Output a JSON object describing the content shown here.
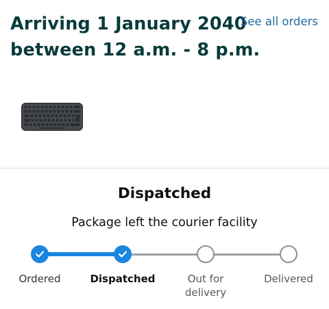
{
  "header": {
    "arrival_line1": "Arriving 1 January 2040",
    "arrival_line2": "between 12 a.m. - 8 p.m.",
    "see_all_orders": "See all orders"
  },
  "product": {
    "image_icon": "keyboard-product-image"
  },
  "status": {
    "title": "Dispatched",
    "subtitle": "Package left the courier facility"
  },
  "tracker": {
    "steps": [
      {
        "label_line1": "Ordered",
        "label_line2": "",
        "state": "done"
      },
      {
        "label_line1": "Dispatched",
        "label_line2": "",
        "state": "current"
      },
      {
        "label_line1": "Out for",
        "label_line2": "delivery",
        "state": "pending"
      },
      {
        "label_line1": "Delivered",
        "label_line2": "",
        "state": "pending"
      }
    ],
    "progress_fraction": 0.333
  },
  "colors": {
    "heading": "#0a3b3b",
    "link": "#1f6aa0",
    "progress_done": "#1a86e0",
    "progress_todo": "#9aa0a6"
  }
}
